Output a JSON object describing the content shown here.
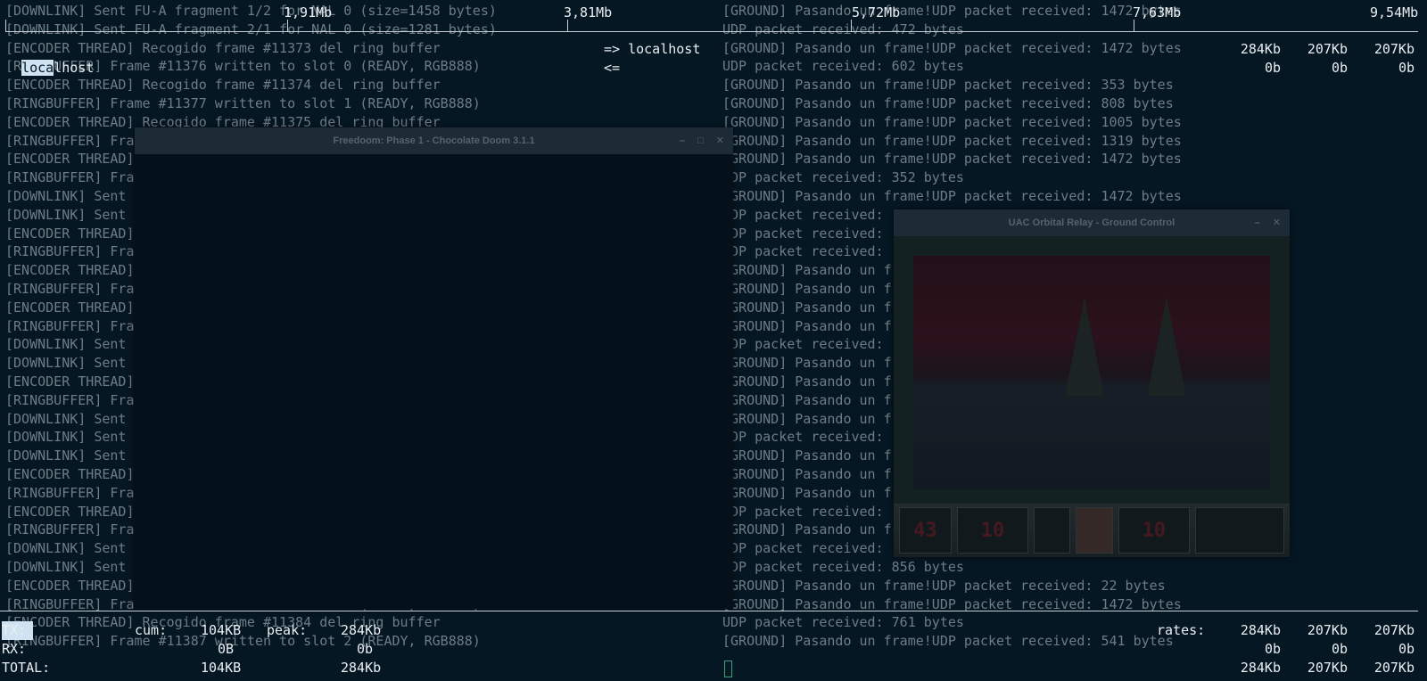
{
  "log_left": [
    "[DOWNLINK] Sent FU-A fragment 1/2 for NAL 0 (size=1458 bytes)",
    "[DOWNLINK] Sent FU-A fragment 2/1 for NAL 0 (size=1281 bytes)",
    "[ENCODER THREAD] Recogido frame #11373 del ring buffer",
    "[RINGBUFFER] Frame #11376 written to slot 0 (READY, RGB888)",
    "[ENCODER THREAD] Recogido frame #11374 del ring buffer",
    "[RINGBUFFER] Frame #11377 written to slot 1 (READY, RGB888)",
    "[ENCODER THREAD] Recogido frame #11375 del ring buffer",
    "[RINGBUFFER] Fra",
    "[ENCODER THREAD]",
    "[RINGBUFFER] Fra",
    "[DOWNLINK] Sent",
    "[DOWNLINK] Sent",
    "[ENCODER THREAD]",
    "[RINGBUFFER] Fra",
    "[ENCODER THREAD]",
    "[RINGBUFFER] Fra",
    "[ENCODER THREAD]",
    "[RINGBUFFER] Fra",
    "[DOWNLINK] Sent",
    "[DOWNLINK] Sent",
    "[ENCODER THREAD]",
    "[RINGBUFFER] Fra",
    "[DOWNLINK] Sent",
    "[DOWNLINK] Sent",
    "[DOWNLINK] Sent",
    "[ENCODER THREAD]",
    "[RINGBUFFER] Fra",
    "[ENCODER THREAD]",
    "[RINGBUFFER] Fra",
    "[DOWNLINK] Sent",
    "[DOWNLINK] Sent",
    "[ENCODER THREAD]",
    "[RINGBUFFER] Frame #11386 written to slot 1 (READY, RGB888)",
    "[ENCODER THREAD] Recogido frame #11384 del ring buffer",
    "[RINGBUFFER] Frame #11387 written to slot 2 (READY, RGB888)"
  ],
  "log_right": [
    "[GROUND] Pasando un frame!UDP packet received: 1472 bytes",
    "UDP packet received: 472 bytes",
    "[GROUND] Pasando un frame!UDP packet received: 1472 bytes",
    "UDP packet received: 602 bytes",
    "[GROUND] Pasando un frame!UDP packet received: 353 bytes",
    "[GROUND] Pasando un frame!UDP packet received: 808 bytes",
    "[GROUND] Pasando un frame!UDP packet received: 1005 bytes",
    "[GROUND] Pasando un frame!UDP packet received: 1319 bytes",
    "[GROUND] Pasando un frame!UDP packet received: 1472 bytes",
    "UDP packet received: 352 bytes",
    "[GROUND] Pasando un frame!UDP packet received: 1472 bytes",
    "UDP packet received:",
    "UDP packet received:",
    "UDP packet received:",
    "[GROUND] Pasando un f",
    "[GROUND] Pasando un f",
    "[GROUND] Pasando un f",
    "[GROUND] Pasando un f",
    "UDP packet received:",
    "[GROUND] Pasando un f",
    "[GROUND] Pasando un f",
    "[GROUND] Pasando un f",
    "[GROUND] Pasando un f",
    "UDP packet received:",
    "[GROUND] Pasando un f",
    "[GROUND] Pasando un f",
    "[GROUND] Pasando un f",
    "UDP packet received:",
    "[GROUND] Pasando un f",
    "UDP packet received:",
    "UDP packet received: 856 bytes",
    "[GROUND] Pasando un frame!UDP packet received: 22 bytes",
    "[GROUND] Pasando un frame!UDP packet received: 1472 bytes",
    "UDP packet received: 761 bytes",
    "[GROUND] Pasando un frame!UDP packet received: 541 bytes"
  ],
  "scale": [
    "1,91Mb",
    "3,81Mb",
    "5,72Mb",
    "7,63Mb",
    "9,54Mb"
  ],
  "host_row1": {
    "host_hl": "loca",
    "host_rest": "lhost",
    "dir": "=> localhost",
    "r2": "284Kb",
    "r10": "207Kb",
    "r40": "207Kb"
  },
  "host_row2": {
    "dir": "<=",
    "r2": "0b",
    "r10": "0b",
    "r40": "0b"
  },
  "totals": {
    "tx_label": "TX:",
    "rx_label": "RX:",
    "total_label": "TOTAL:",
    "cum_label": "cum:",
    "peak_label": "peak:",
    "rates_label": "rates:",
    "tx_cum": "104KB",
    "tx_peak": "284Kb",
    "tx_r2": "284Kb",
    "tx_r10": "207Kb",
    "tx_r40": "207Kb",
    "rx_cum": "0B",
    "rx_peak": "0b",
    "rx_r2": "0b",
    "rx_r10": "0b",
    "rx_r40": "0b",
    "total_cum": "104KB",
    "total_peak": "284Kb",
    "total_r2": "284Kb",
    "total_r10": "207Kb",
    "total_r40": "207Kb"
  },
  "win_doom": {
    "title": "Freedoom: Phase 1 - Chocolate Doom 3.1.1",
    "min": "–",
    "max": "□",
    "close": "✕"
  },
  "win_relay": {
    "title": "UAC Orbital Relay - Ground Control",
    "min": "–",
    "close": "✕",
    "hud": {
      "ammo": "43",
      "health": "10",
      "armor": "10"
    }
  }
}
